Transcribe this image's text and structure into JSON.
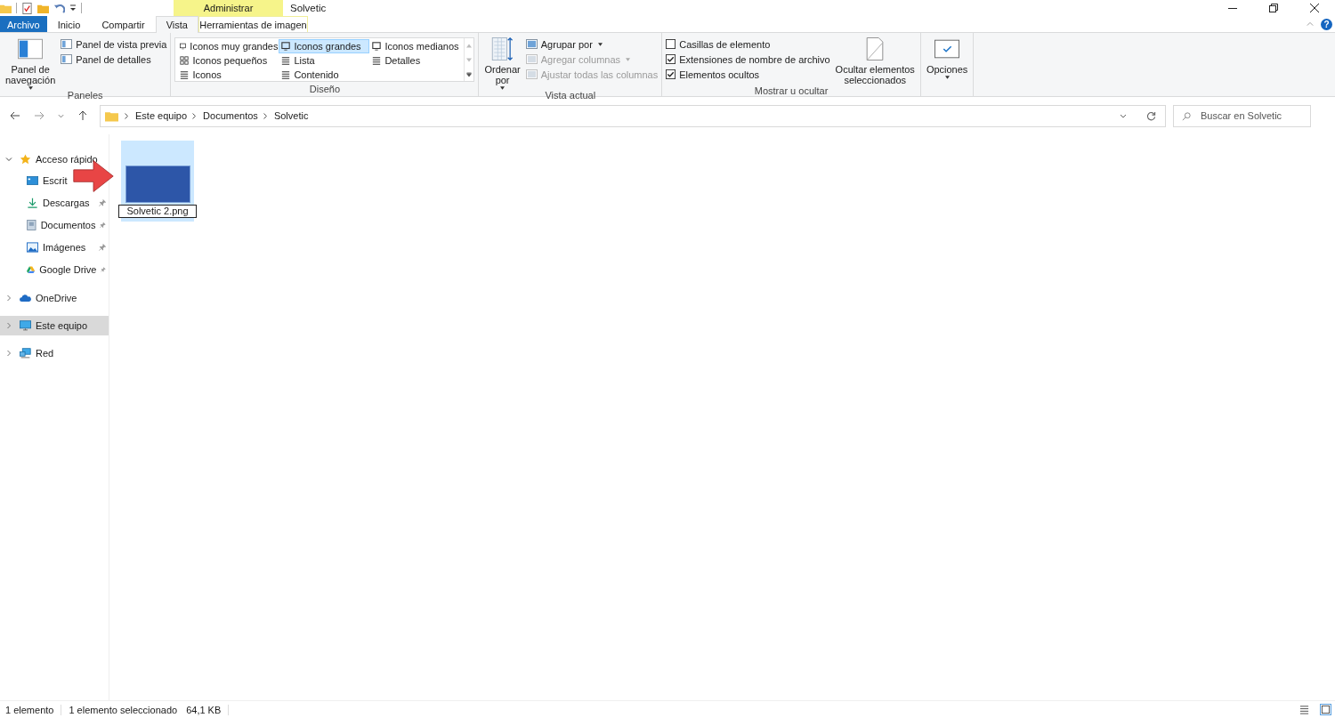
{
  "window": {
    "title": "Solvetic"
  },
  "contextual_tab": {
    "group": "Administrar",
    "label": "Herramientas de imagen",
    "selected": false
  },
  "help_button": {
    "label": "?"
  },
  "tabs": [
    {
      "label": "Archivo",
      "kind": "file",
      "selected": false
    },
    {
      "label": "Inicio",
      "kind": "tab",
      "selected": false
    },
    {
      "label": "Compartir",
      "kind": "tab",
      "selected": false
    },
    {
      "label": "Vista",
      "kind": "tab",
      "selected": true
    }
  ],
  "ribbon": {
    "groups": [
      {
        "label": "Paneles",
        "items": [
          {
            "kind": "large",
            "lines": [
              "Panel de",
              "navegación"
            ],
            "dropdown": true,
            "disabled": false
          },
          {
            "kind": "small",
            "label": "Panel de vista previa",
            "dropdown": false,
            "disabled": false
          },
          {
            "kind": "small",
            "label": "Panel de detalles",
            "dropdown": false,
            "disabled": false
          }
        ]
      },
      {
        "label": "Diseño",
        "items": [
          {
            "kind": "gallery",
            "options": [
              {
                "label": "Iconos muy grandes",
                "selected": false
              },
              {
                "label": "Iconos grandes",
                "selected": true
              },
              {
                "label": "Iconos medianos",
                "selected": false
              },
              {
                "label": "Iconos pequeños",
                "selected": false
              },
              {
                "label": "Lista",
                "selected": false
              },
              {
                "label": "Detalles",
                "selected": false
              },
              {
                "label": "Iconos",
                "selected": false
              },
              {
                "label": "Contenido",
                "selected": false
              }
            ]
          }
        ]
      },
      {
        "label": "Vista actual",
        "items": [
          {
            "kind": "large",
            "lines": [
              "Ordenar",
              "por"
            ],
            "dropdown": true,
            "disabled": false
          },
          {
            "kind": "small",
            "label": "Agrupar por",
            "dropdown": true,
            "disabled": false
          },
          {
            "kind": "small",
            "label": "Agregar columnas",
            "dropdown": true,
            "disabled": true
          },
          {
            "kind": "small",
            "label": "Ajustar todas las columnas",
            "dropdown": false,
            "disabled": true
          }
        ]
      },
      {
        "label": "Mostrar u ocultar",
        "items": [
          {
            "kind": "checkbox",
            "label": "Casillas de elemento",
            "checked": false
          },
          {
            "kind": "checkbox",
            "label": "Extensiones de nombre de archivo",
            "checked": true
          },
          {
            "kind": "checkbox",
            "label": "Elementos ocultos",
            "checked": true
          },
          {
            "kind": "large",
            "lines": [
              "Ocultar elementos",
              "seleccionados"
            ],
            "dropdown": false,
            "disabled": false
          }
        ]
      },
      {
        "items": [
          {
            "kind": "large",
            "lines": [
              "Opciones"
            ],
            "dropdown": true,
            "disabled": false
          }
        ]
      }
    ]
  },
  "address": {
    "path": [
      "Este equipo",
      "Documentos",
      "Solvetic"
    ]
  },
  "search": {
    "placeholder": "Buscar en Solvetic"
  },
  "navigation": [
    {
      "label": "Acceso rápido",
      "expanded": true,
      "selected": false,
      "children": [
        {
          "label": "Escrit",
          "selected": false
        },
        {
          "label": "Descargas",
          "pinned": true,
          "selected": false
        },
        {
          "label": "Documentos",
          "pinned": true,
          "selected": false
        },
        {
          "label": "Imágenes",
          "pinned": true,
          "selected": false
        },
        {
          "label": "Google Drive",
          "pinned": true,
          "selected": false
        }
      ]
    },
    {
      "label": "OneDrive",
      "expanded": false,
      "selected": false
    },
    {
      "label": "Este equipo",
      "expanded": false,
      "selected": true
    },
    {
      "label": "Red",
      "expanded": false,
      "selected": false
    }
  ],
  "files": [
    {
      "name": "Solvetic 2.png",
      "selected": true,
      "renaming": true
    }
  ],
  "status_bar": {
    "count": "1 elemento",
    "selection": "1 elemento seleccionado",
    "size": "64,1 KB"
  }
}
